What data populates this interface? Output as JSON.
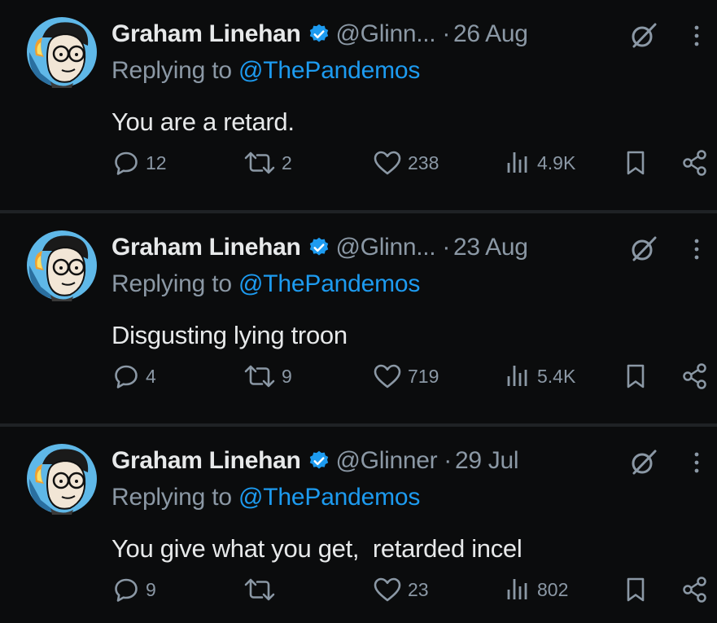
{
  "colors": {
    "background": "#000000",
    "card": "#0b0c0d",
    "text": "#e7e9ea",
    "muted": "#8b98a5",
    "accent": "#1d9bf0"
  },
  "icons": {
    "verified": "verified-badge-icon",
    "grok": "grok-icon",
    "more": "more-options-icon",
    "reply": "reply-icon",
    "repost": "repost-icon",
    "like": "like-icon",
    "views": "views-icon",
    "bookmark": "bookmark-icon",
    "share": "share-icon"
  },
  "tweets": [
    {
      "author": "Graham Linehan",
      "handle": "@Glinn...",
      "date": "26 Aug",
      "dot": "·",
      "replying_prefix": "Replying to",
      "replying_to": "@ThePandemos",
      "text": "You are a retard.",
      "replies": "12",
      "reposts": "2",
      "likes": "238",
      "views": "4.9K"
    },
    {
      "author": "Graham Linehan",
      "handle": "@Glinn...",
      "date": "23 Aug",
      "dot": "·",
      "replying_prefix": "Replying to",
      "replying_to": "@ThePandemos",
      "text": "Disgusting lying troon",
      "replies": "4",
      "reposts": "9",
      "likes": "719",
      "views": "5.4K"
    },
    {
      "author": "Graham Linehan",
      "handle": "@Glinner",
      "date": "29 Jul",
      "dot": "·",
      "replying_prefix": "Replying to",
      "replying_to": "@ThePandemos",
      "text": "You give what you get,  retarded incel",
      "replies": "9",
      "reposts": "",
      "likes": "23",
      "views": "802"
    }
  ]
}
